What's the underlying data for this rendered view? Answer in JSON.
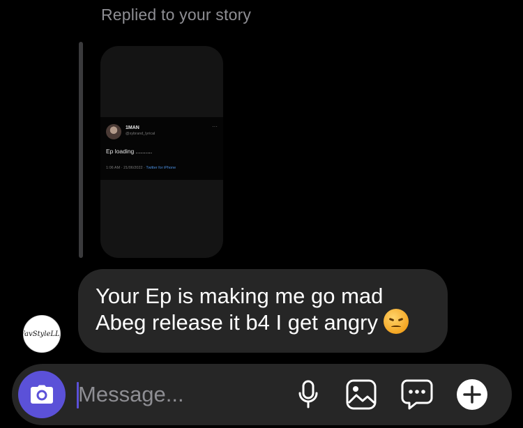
{
  "thread": {
    "replied_label": "Replied to your story",
    "story": {
      "tweet_name": "1MAN",
      "tweet_handle": "@xybrand_lyrical",
      "tweet_more": "···",
      "tweet_text": "Ep loading ..........",
      "tweet_time": "1:06 AM · 21/06/2022 · ",
      "tweet_source": "Twitter for iPhone"
    },
    "message": {
      "avatar_text": "FavStyleLLy",
      "line1": "Your Ep is making me go mad",
      "line2": "Abeg release it b4 I get angry",
      "emoji": "angry-face"
    }
  },
  "composer": {
    "placeholder": "Message...",
    "value": "",
    "buttons": [
      {
        "name": "camera",
        "icon": "camera-icon"
      },
      {
        "name": "voice",
        "icon": "microphone-icon"
      },
      {
        "name": "gallery",
        "icon": "image-icon"
      },
      {
        "name": "sticker",
        "icon": "chat-bubble-icon"
      },
      {
        "name": "more",
        "icon": "plus-circle-icon"
      }
    ]
  },
  "colors": {
    "background": "#000000",
    "bubble": "#262626",
    "accent": "#5b51d8",
    "muted_text": "#8e8e93"
  }
}
